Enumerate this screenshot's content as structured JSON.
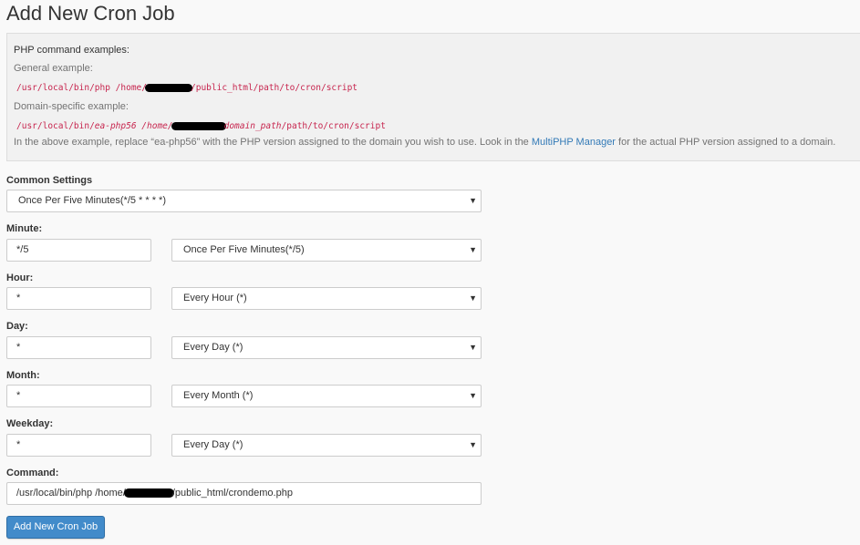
{
  "page_title": "Add New Cron Job",
  "examples": {
    "heading": "PHP command examples:",
    "general_label": "General example:",
    "general_code_prefix": "/usr/local/bin/php /home/",
    "general_code_suffix": "/public_html/path/to/cron/script",
    "domain_label": "Domain-specific example:",
    "domain_code_prefix": "/usr/local/bin/",
    "domain_code_php": "ea-php56",
    "domain_code_home": " /home/",
    "domain_code_path": "domain_path",
    "domain_code_suffix": "/path/to/cron/script",
    "note_before": "In the above example, replace “ea-php56” with the PHP version assigned to the domain you wish to use. Look in the ",
    "note_link": "MultiPHP Manager",
    "note_after": " for the actual PHP version assigned to a domain."
  },
  "common_settings": {
    "label": "Common Settings",
    "selected": "Once Per Five Minutes(*/5 * * * *)"
  },
  "fields": {
    "minute": {
      "label": "Minute:",
      "value": "*/5",
      "selected": "Once Per Five Minutes(*/5)"
    },
    "hour": {
      "label": "Hour:",
      "value": "*",
      "selected": "Every Hour (*)"
    },
    "day": {
      "label": "Day:",
      "value": "*",
      "selected": "Every Day (*)"
    },
    "month": {
      "label": "Month:",
      "value": "*",
      "selected": "Every Month (*)"
    },
    "weekday": {
      "label": "Weekday:",
      "value": "*",
      "selected": "Every Day (*)"
    }
  },
  "command": {
    "label": "Command:",
    "value_prefix": "/usr/local/bin/php /home/",
    "value_suffix": "/public_html/crondemo.php"
  },
  "submit_label": "Add New Cron Job",
  "colors": {
    "accent": "#428bca",
    "link": "#337ab7",
    "code": "#c7254e",
    "panel_bg": "#f1f1f1",
    "page_bg": "#f9f9f9"
  }
}
